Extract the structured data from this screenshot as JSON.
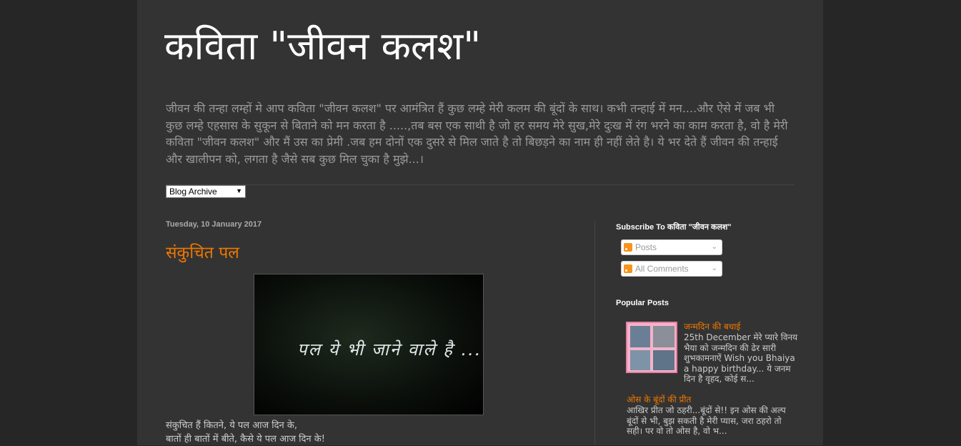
{
  "header": {
    "title": "कविता \"जीवन कलश\"",
    "description": "जीवन की तन्हा लम्हों मे आप कविता \"जीवन कलश\" पर आमंत्रित हैं कुछ लम्हे मेरी कलम की बूंदों के साथ। कभी तन्हाई में मन....और ऐसे में जब भी कुछ लम्हे एहसास के सुकून से बिताने को मन करता है .....,तब बस एक साथी है जो हर समय मेरे सुख,मेरे दुःख में रंग भरने का काम करता है, वो है मेरी कविता \"जीवन कलश\" और मैं उस का प्रेमी .जब हम दोनों एक दुसरे से मिल जाते है तो बिछड़ने का नाम ही नहीं लेते है। ये भर देते हैं जीवन की तन्हाई और खालीपन को, लगता है जैसे सब कुछ मिल चुका है मुझे...।"
  },
  "archive": {
    "label": "Blog Archive",
    "arrow": "▼"
  },
  "post": {
    "date": "Tuesday, 10 January 2017",
    "title": "संकुचित पल",
    "image_text": "पल ये भी जाने वाले है ...",
    "lines": [
      "संकुचित हैं कितने, ये पल आज दिन के,",
      "बातों ही बातों में बीते, कैसे ये पल आज दिन के!"
    ]
  },
  "sidebar": {
    "subscribe_title": "Subscribe To कविता \"जीवन कलश\"",
    "feeds": [
      {
        "label": "Posts"
      },
      {
        "label": "All Comments"
      }
    ],
    "feed_chevron": "⌄",
    "popular_title": "Popular Posts",
    "popular_posts": [
      {
        "title": "जन्मदिन की बधाई",
        "snippet": "25th December मेरे प्यारे विनय भैया को जन्मदिन की ढेर सारी शुभकामनाऐं Wish you Bhaiya a happy birthday... ये जनम दिन है वृहद, कोई स..."
      },
      {
        "title": "ओस के बूंदों की प्रीत",
        "snippet": "आखिर प्रीत जो ठहरी...बूंदों से!! इन ओस की अल्प बूंदों से भी, बुझ सकती है  मेरी प्यास, जरा ठहरो तो सही। पर वो तो ओस है, वो भ..."
      }
    ]
  },
  "colors": {
    "background": "#262626",
    "content_bg": "#333333",
    "title": "#ffffff",
    "accent": "#ee7700",
    "text": "#cccccc"
  }
}
